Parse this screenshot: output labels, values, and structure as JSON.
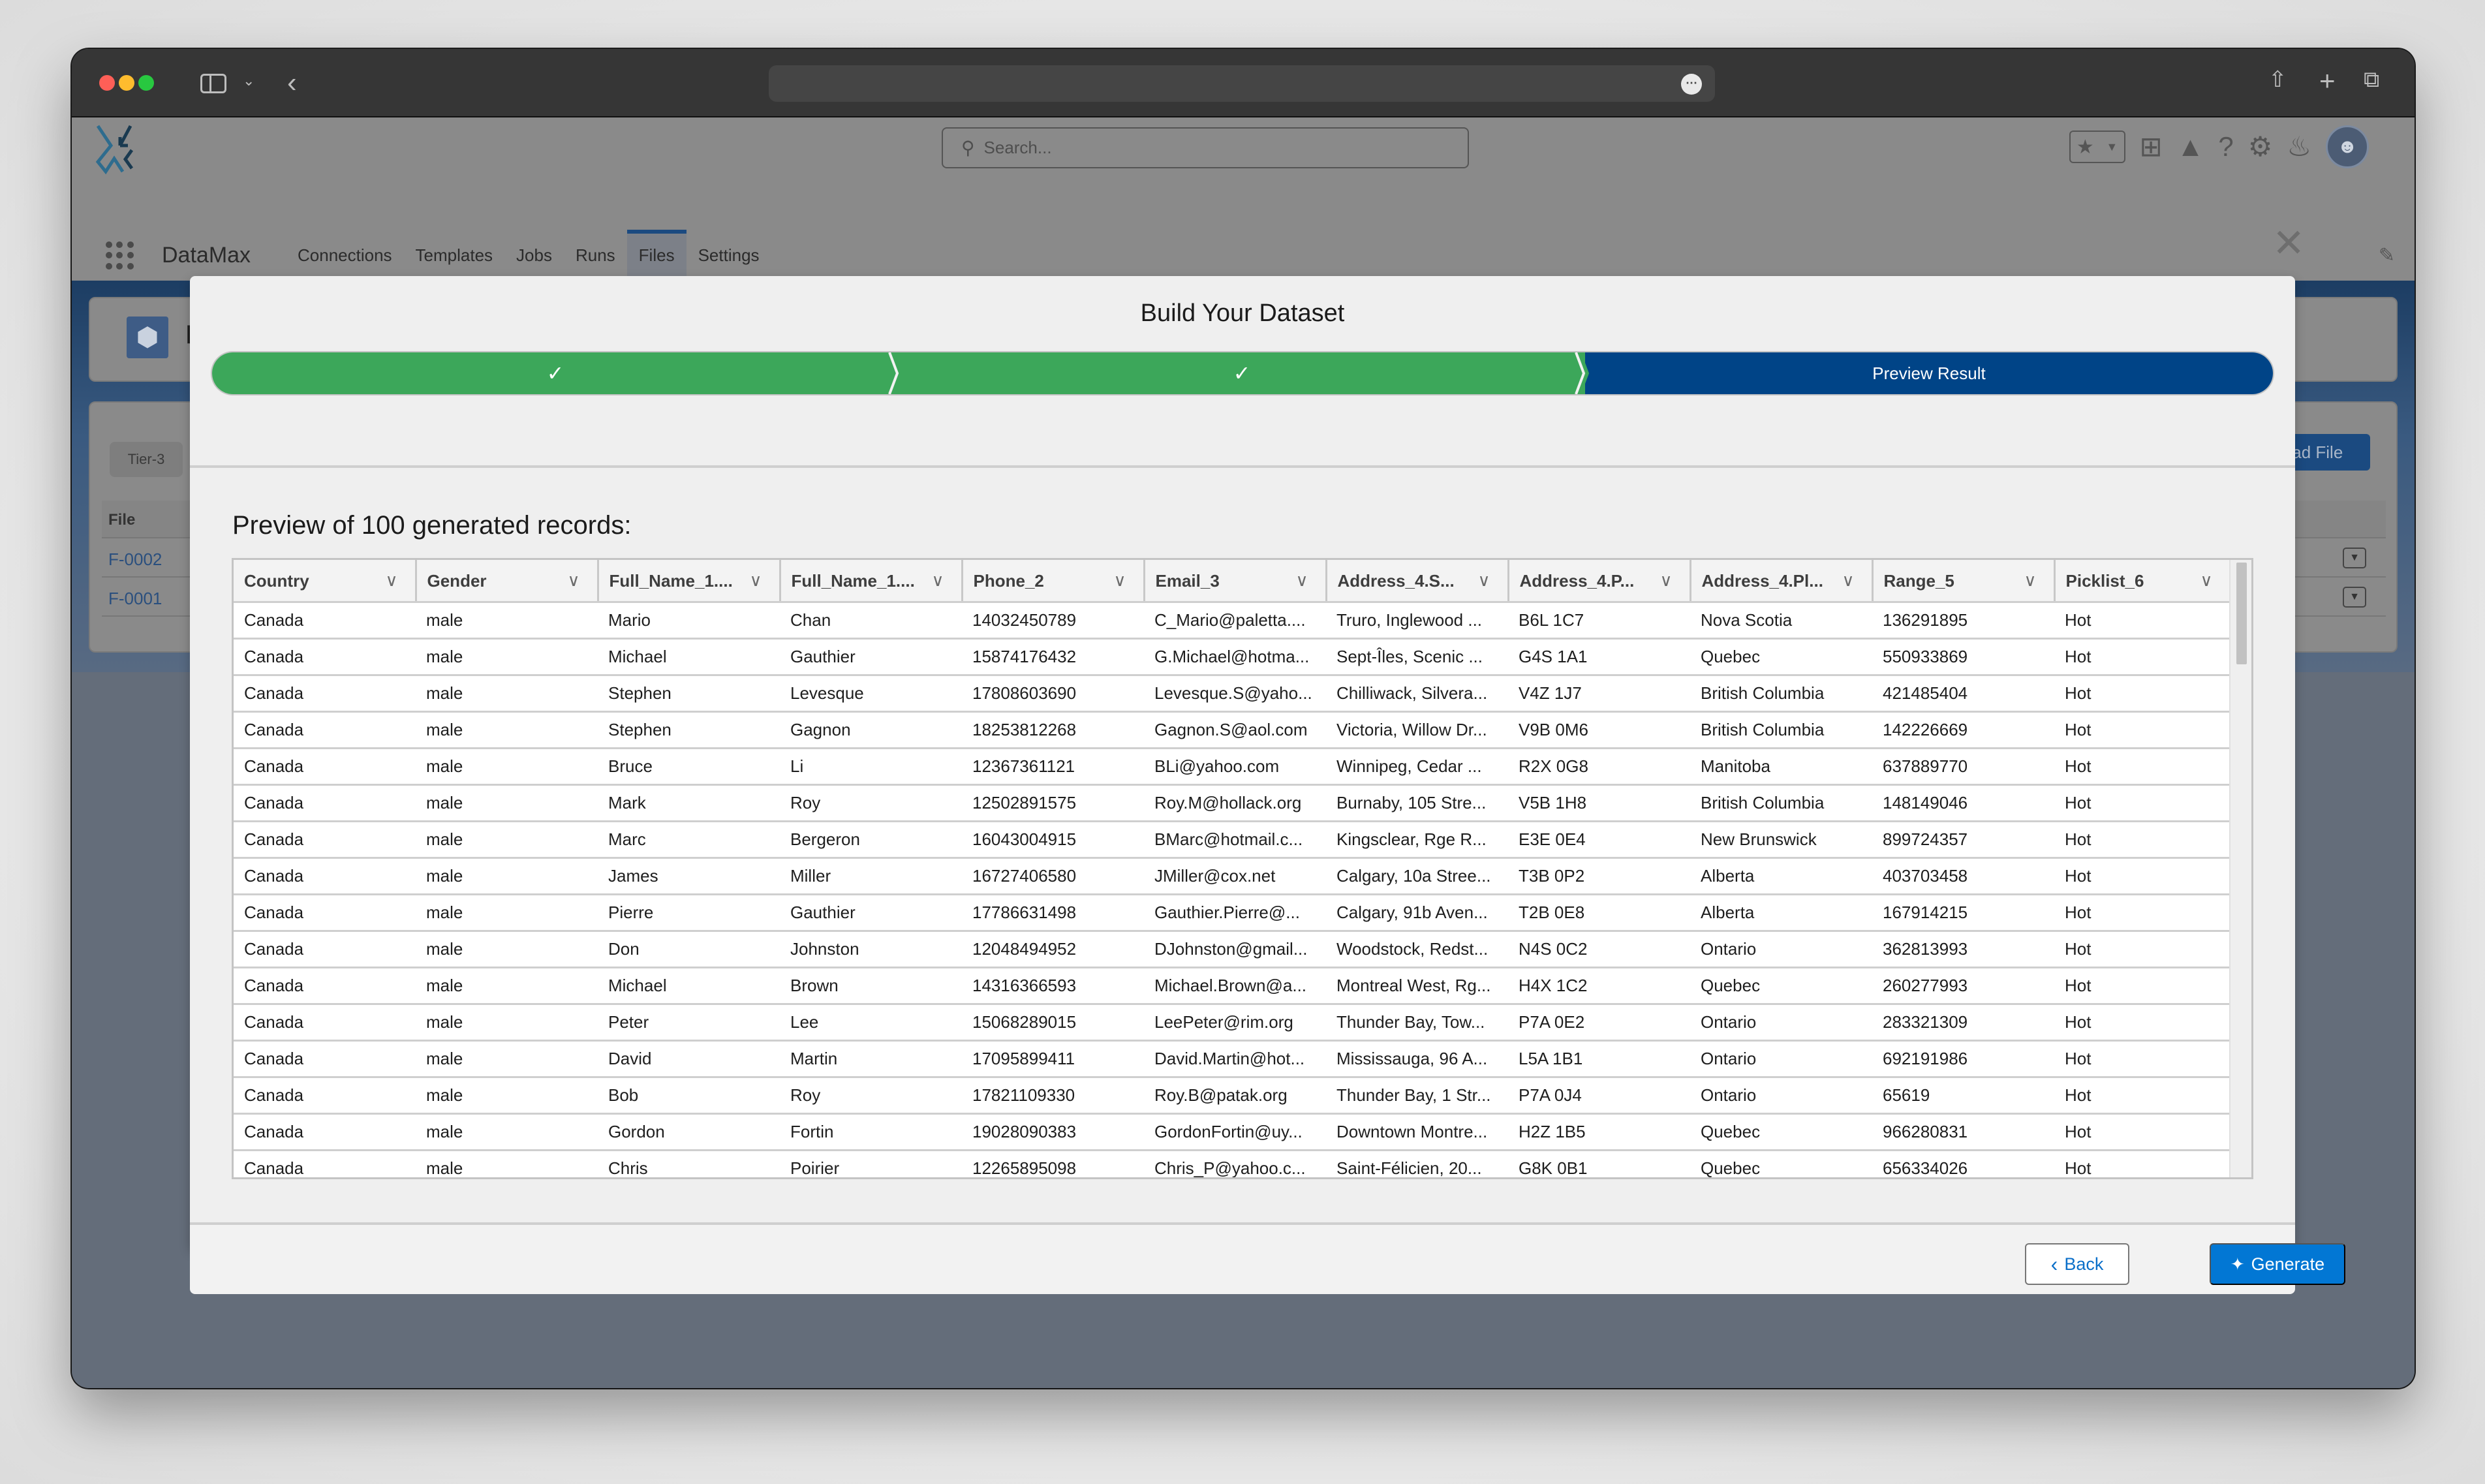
{
  "browser": {
    "url": "",
    "icons": [
      "sidebar-toggle-icon",
      "chevron-down-icon",
      "back-icon",
      "more-icon",
      "share-icon",
      "new-tab-icon",
      "tabs-overview-icon"
    ]
  },
  "app": {
    "name": "DataMax",
    "search_placeholder": "Search...",
    "nav_tabs": [
      {
        "label": "Connections",
        "active": false
      },
      {
        "label": "Templates",
        "active": false
      },
      {
        "label": "Jobs",
        "active": false
      },
      {
        "label": "Runs",
        "active": false
      },
      {
        "label": "Files",
        "active": true
      },
      {
        "label": "Settings",
        "active": false
      }
    ],
    "header_icons": [
      "favorites-star-icon",
      "favorites-dropdown-icon",
      "add-icon",
      "trailhead-icon",
      "help-icon",
      "settings-gear-icon",
      "notifications-bell-icon",
      "user-avatar"
    ]
  },
  "background_page": {
    "title": "Fi",
    "tier_chip": "Tier-3",
    "upload_button": "load File",
    "table_header": "File",
    "rows": [
      "F-0002",
      "F-0001"
    ]
  },
  "modal": {
    "title": "Build Your Dataset",
    "steps": [
      {
        "label": "",
        "status": "complete",
        "icon": "check-icon"
      },
      {
        "label": "",
        "status": "complete",
        "icon": "check-icon"
      },
      {
        "label": "Preview Result",
        "status": "current"
      }
    ],
    "preview_heading": "Preview of 100 generated records:",
    "columns": [
      "Country",
      "Gender",
      "Full_Name_1....",
      "Full_Name_1....",
      "Phone_2",
      "Email_3",
      "Address_4.S...",
      "Address_4.P...",
      "Address_4.Pl...",
      "Range_5",
      "Picklist_6"
    ],
    "rows": [
      [
        "Canada",
        "male",
        "Mario",
        "Chan",
        "14032450789",
        "C_Mario@paletta....",
        "Truro, Inglewood ...",
        "B6L 1C7",
        "Nova Scotia",
        "136291895",
        "Hot"
      ],
      [
        "Canada",
        "male",
        "Michael",
        "Gauthier",
        "15874176432",
        "G.Michael@hotma...",
        "Sept-Îles, Scenic ...",
        "G4S 1A1",
        "Quebec",
        "550933869",
        "Hot"
      ],
      [
        "Canada",
        "male",
        "Stephen",
        "Levesque",
        "17808603690",
        "Levesque.S@yaho...",
        "Chilliwack, Silvera...",
        "V4Z 1J7",
        "British Columbia",
        "421485404",
        "Hot"
      ],
      [
        "Canada",
        "male",
        "Stephen",
        "Gagnon",
        "18253812268",
        "Gagnon.S@aol.com",
        "Victoria, Willow Dr...",
        "V9B 0M6",
        "British Columbia",
        "142226669",
        "Hot"
      ],
      [
        "Canada",
        "male",
        "Bruce",
        "Li",
        "12367361121",
        "BLi@yahoo.com",
        "Winnipeg, Cedar ...",
        "R2X 0G8",
        "Manitoba",
        "637889770",
        "Hot"
      ],
      [
        "Canada",
        "male",
        "Mark",
        "Roy",
        "12502891575",
        "Roy.M@hollack.org",
        "Burnaby, 105 Stre...",
        "V5B 1H8",
        "British Columbia",
        "148149046",
        "Hot"
      ],
      [
        "Canada",
        "male",
        "Marc",
        "Bergeron",
        "16043004915",
        "BMarc@hotmail.c...",
        "Kingsclear, Rge R...",
        "E3E 0E4",
        "New Brunswick",
        "899724357",
        "Hot"
      ],
      [
        "Canada",
        "male",
        "James",
        "Miller",
        "16727406580",
        "JMiller@cox.net",
        "Calgary, 10a Stree...",
        "T3B 0P2",
        "Alberta",
        "403703458",
        "Hot"
      ],
      [
        "Canada",
        "male",
        "Pierre",
        "Gauthier",
        "17786631498",
        "Gauthier.Pierre@...",
        "Calgary, 91b Aven...",
        "T2B 0E8",
        "Alberta",
        "167914215",
        "Hot"
      ],
      [
        "Canada",
        "male",
        "Don",
        "Johnston",
        "12048494952",
        "DJohnston@gmail...",
        "Woodstock, Redst...",
        "N4S 0C2",
        "Ontario",
        "362813993",
        "Hot"
      ],
      [
        "Canada",
        "male",
        "Michael",
        "Brown",
        "14316366593",
        "Michael.Brown@a...",
        "Montreal West, Rg...",
        "H4X 1C2",
        "Quebec",
        "260277993",
        "Hot"
      ],
      [
        "Canada",
        "male",
        "Peter",
        "Lee",
        "15068289015",
        "LeePeter@rim.org",
        "Thunder Bay, Tow...",
        "P7A 0E2",
        "Ontario",
        "283321309",
        "Hot"
      ],
      [
        "Canada",
        "male",
        "David",
        "Martin",
        "17095899411",
        "David.Martin@hot...",
        "Mississauga, 96 A...",
        "L5A 1B1",
        "Ontario",
        "692191986",
        "Hot"
      ],
      [
        "Canada",
        "male",
        "Bob",
        "Roy",
        "17821109330",
        "Roy.B@patak.org",
        "Thunder Bay, 1 Str...",
        "P7A 0J4",
        "Ontario",
        "65619",
        "Hot"
      ],
      [
        "Canada",
        "male",
        "Gordon",
        "Fortin",
        "19028090383",
        "GordonFortin@uy...",
        "Downtown Montre...",
        "H2Z 1B5",
        "Quebec",
        "966280831",
        "Hot"
      ],
      [
        "Canada",
        "male",
        "Chris",
        "Poirier",
        "12265895098",
        "Chris_P@yahoo.c...",
        "Saint-Félicien, 20...",
        "G8K 0B1",
        "Quebec",
        "656334026",
        "Hot"
      ]
    ],
    "back_label": "Back",
    "generate_label": "Generate"
  },
  "colors": {
    "step_complete": "#3ca75a",
    "step_current": "#004487",
    "primary_button": "#0277d4",
    "overlay": "#646d7a"
  }
}
